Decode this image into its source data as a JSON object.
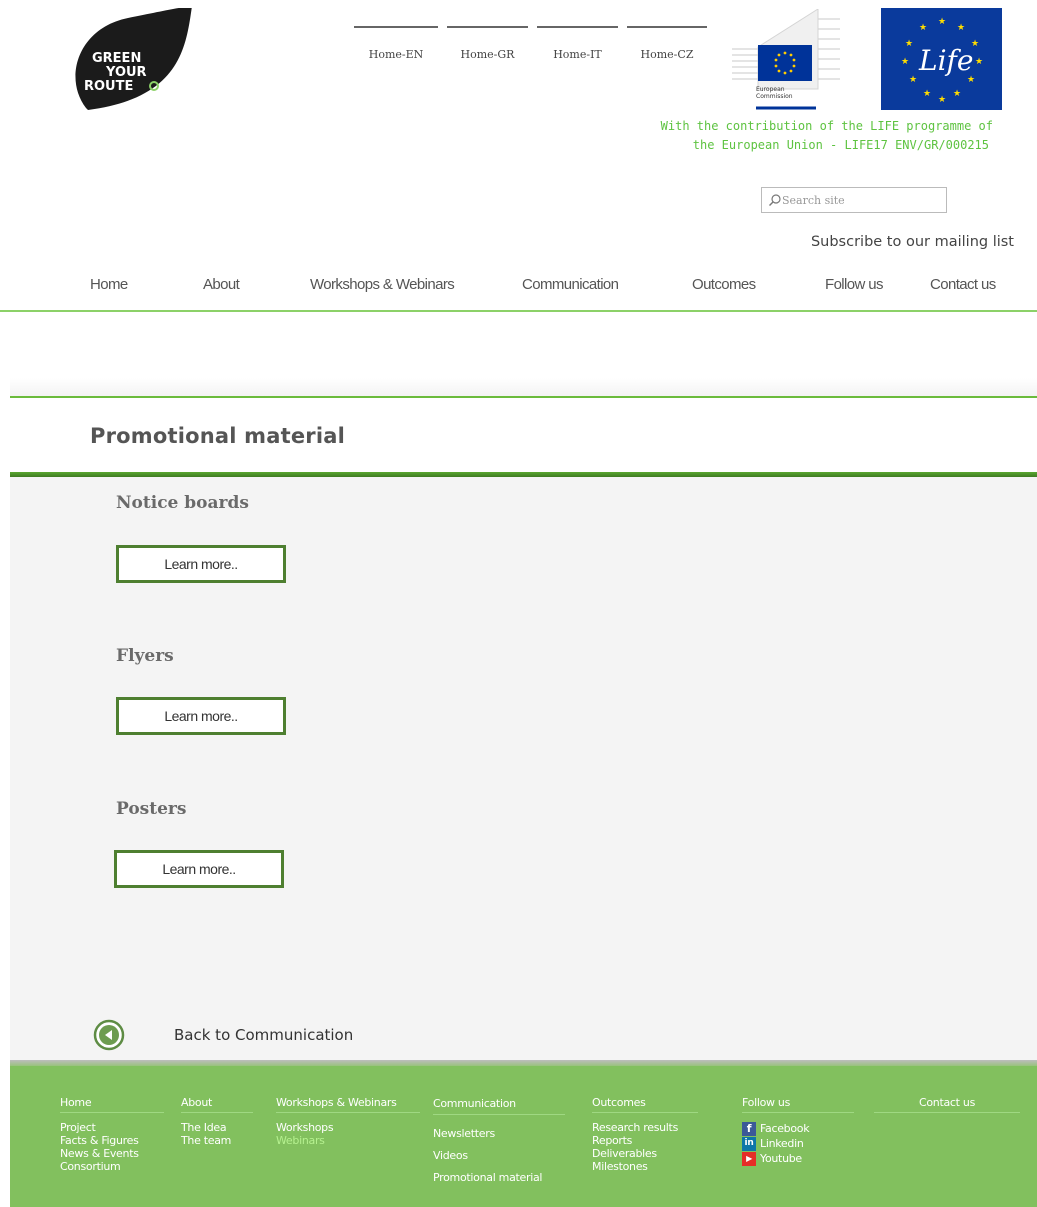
{
  "logo": {
    "lines": [
      "GREEN",
      "YOUR",
      "ROUTE"
    ]
  },
  "languages": [
    "Home-EN",
    "Home-GR",
    "Home-IT",
    "Home-CZ"
  ],
  "ec_logo": {
    "line1": "European",
    "line2": "Commission"
  },
  "life_logo": {
    "text": "Life"
  },
  "contribution": {
    "line1": "With the contribution of the LIFE programme of",
    "line2": "the European Union - LIFE17 ENV/GR/000215"
  },
  "search": {
    "placeholder": "Search site"
  },
  "subscribe": "Subscribe to our mailing list",
  "nav": [
    "Home",
    "About",
    "Workshops & Webinars",
    "Communication",
    "Outcomes",
    "Follow us",
    "Contact us"
  ],
  "page_title": "Promotional material",
  "sections": [
    {
      "heading": "Notice boards",
      "button": "Learn more.."
    },
    {
      "heading": "Flyers",
      "button": "Learn more.."
    },
    {
      "heading": "Posters",
      "button": "Learn more.."
    }
  ],
  "back": "Back to Communication",
  "footer": {
    "columns": [
      {
        "head": "Home",
        "items": [
          "Project",
          "Facts & Figures",
          "News & Events",
          "Consortium"
        ]
      },
      {
        "head": "About",
        "items": [
          "The Idea",
          "The team"
        ]
      },
      {
        "head": "Workshops & Webinars",
        "items": [
          "Workshops",
          "Webinars"
        ]
      },
      {
        "head": "Communication",
        "items": [
          "Newsletters",
          "Videos",
          "Promotional material"
        ]
      },
      {
        "head": "Outcomes",
        "items": [
          "Research results",
          "Reports",
          "Deliverables",
          "Milestones"
        ]
      },
      {
        "head": "Follow us",
        "items": [
          "Facebook",
          "Linkedin",
          "Youtube"
        ]
      },
      {
        "head": "Contact us",
        "items": []
      }
    ]
  },
  "colors": {
    "brand_green": "#5ec341",
    "footer_green": "#82c05e",
    "button_border": "#4e7f30"
  }
}
